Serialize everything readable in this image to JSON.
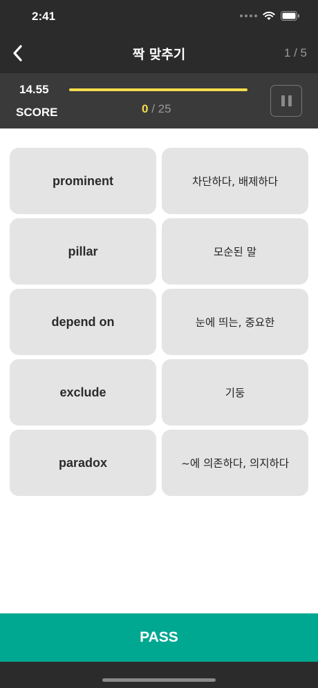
{
  "status": {
    "time": "2:41"
  },
  "nav": {
    "title": "짝 맞추기",
    "counter": "1 / 5"
  },
  "score": {
    "value": "14.55",
    "label": "SCORE",
    "progress": 1.0,
    "matched": "0",
    "total_text": " / 25"
  },
  "cards": [
    {
      "text": "prominent",
      "lang": "en"
    },
    {
      "text": "차단하다, 배제하다",
      "lang": "ko"
    },
    {
      "text": "pillar",
      "lang": "en"
    },
    {
      "text": "모순된 말",
      "lang": "ko"
    },
    {
      "text": "depend on",
      "lang": "en"
    },
    {
      "text": "눈에 띄는, 중요한",
      "lang": "ko"
    },
    {
      "text": "exclude",
      "lang": "en"
    },
    {
      "text": "기둥",
      "lang": "ko"
    },
    {
      "text": "paradox",
      "lang": "en"
    },
    {
      "text": "~에 의존하다, 의지하다",
      "lang": "ko"
    }
  ],
  "pass_label": "PASS",
  "colors": {
    "accent": "#00a891",
    "progress": "#f5dc4c",
    "header": "#2b2b2b",
    "score_bg": "#3a3a3a",
    "card": "#e4e4e4"
  }
}
